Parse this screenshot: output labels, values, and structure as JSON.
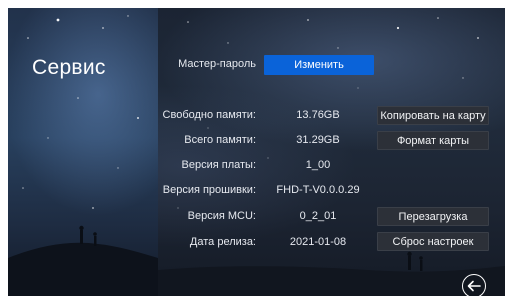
{
  "page": {
    "title": "Сервис"
  },
  "master_password": {
    "label": "Мастер-пароль",
    "button": "Изменить"
  },
  "rows": [
    {
      "label": "Свободно памяти:",
      "value": "13.76GB",
      "button": "Копировать на карту"
    },
    {
      "label": "Всего памяти:",
      "value": "31.29GB",
      "button": "Формат карты"
    },
    {
      "label": "Версия платы:",
      "value": "1_00"
    },
    {
      "label": "Версия прошивки:",
      "value": "FHD-T-V0.0.0.29"
    },
    {
      "label": "Версия MCU:",
      "value": "0_2_01",
      "button": "Перезагрузка"
    },
    {
      "label": "Дата релиза:",
      "value": "2021-01-08",
      "button": "Сброс настроек"
    }
  ],
  "icons": {
    "back": "back-arrow-circle-icon"
  },
  "colors": {
    "accent": "#0a63d9",
    "button_dark": "#2c3038",
    "text": "#e6e9ef"
  }
}
